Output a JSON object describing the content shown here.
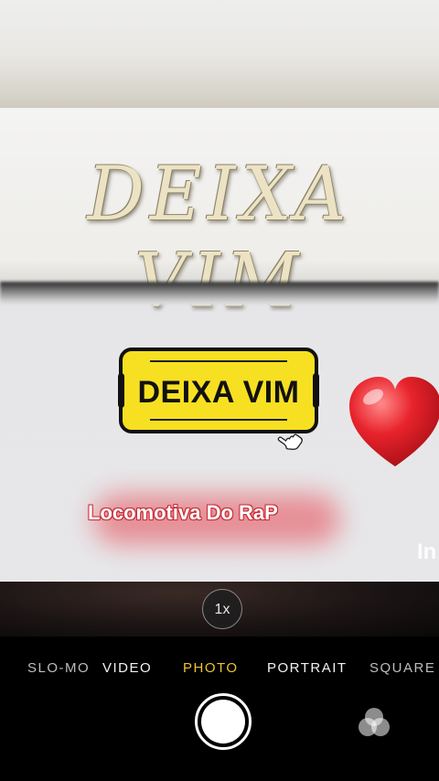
{
  "video": {
    "big_title": "DEIXA VIM",
    "badge_title": "DEIXA VIM",
    "artist": "Locomotiva Do RaP",
    "edge_text": "In"
  },
  "camera": {
    "zoom": "1x",
    "modes": [
      {
        "label": "SLO-MO"
      },
      {
        "label": "VIDEO"
      },
      {
        "label": "PHOTO"
      },
      {
        "label": "PORTRAIT"
      },
      {
        "label": "SQUARE"
      }
    ],
    "active_mode": "PHOTO"
  },
  "colors": {
    "active_mode": "#f1c232",
    "badge_yellow": "#f7e021",
    "heart_red": "#e0202a"
  },
  "icons": {
    "cursor": "hand-pointer-icon",
    "heart": "heart-icon",
    "filters": "filters-icon",
    "shutter": "shutter-icon"
  }
}
